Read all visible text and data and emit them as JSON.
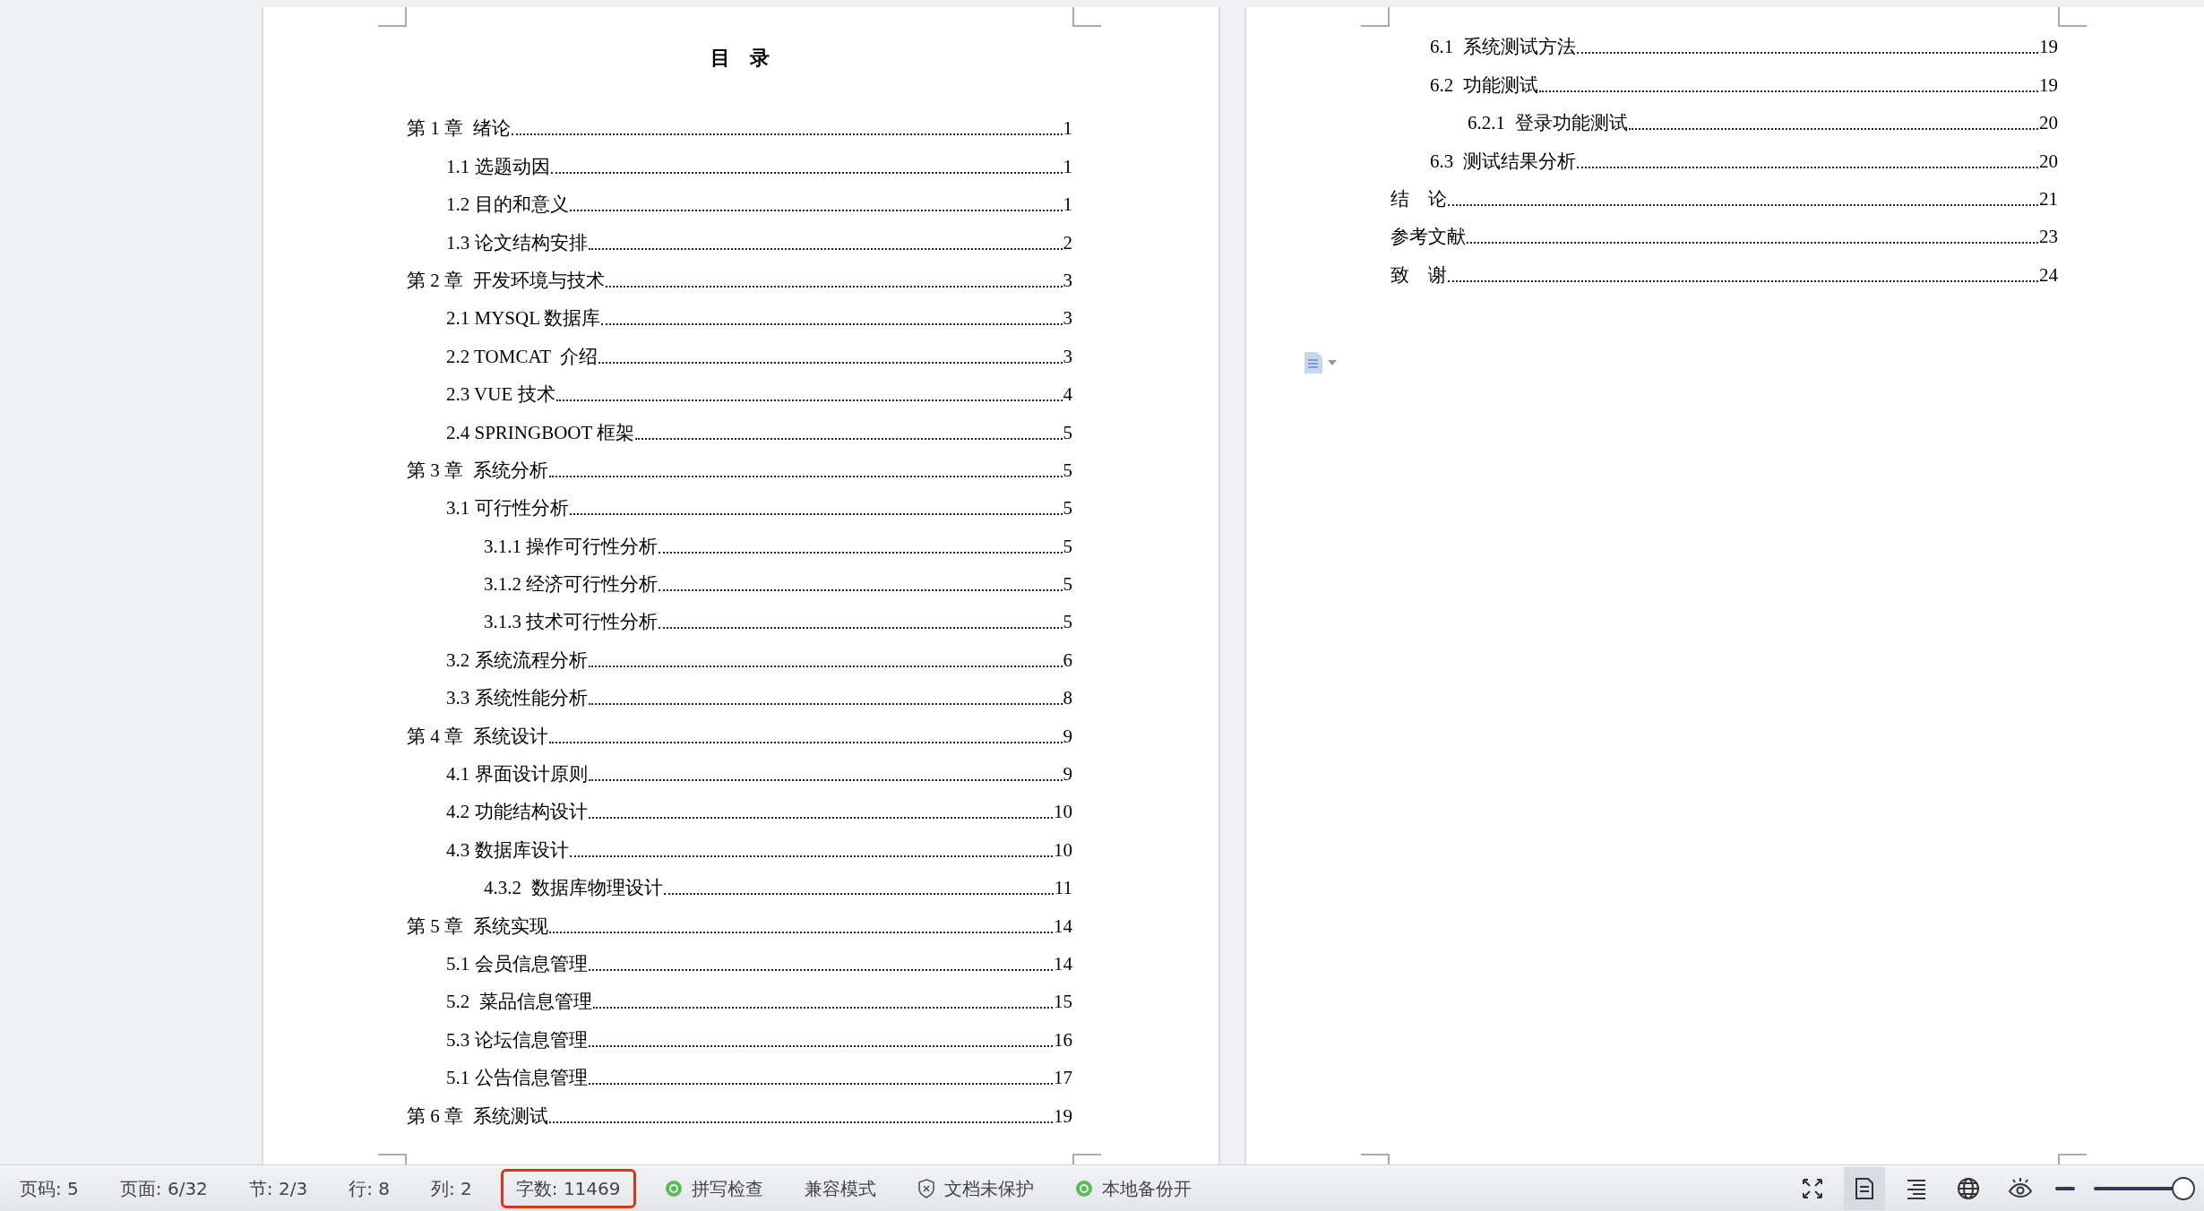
{
  "document": {
    "title": "目　录",
    "left_page": {
      "entries": [
        {
          "label": "第 1 章  绪论",
          "page": "1",
          "children": [
            {
              "label": "1.1 选题动因",
              "page": "1"
            },
            {
              "label": "1.2 目的和意义",
              "page": "1"
            },
            {
              "label": "1.3 论文结构安排",
              "page": "2"
            }
          ]
        },
        {
          "label": "第 2 章  开发环境与技术",
          "page": "3",
          "children": [
            {
              "label": "2.1 MYSQL 数据库",
              "page": "3"
            },
            {
              "label": "2.2 TOMCAT  介绍",
              "page": "3"
            },
            {
              "label": "2.3 VUE 技术",
              "page": "4"
            },
            {
              "label": "2.4 SPRINGBOOT 框架",
              "page": "5"
            }
          ]
        },
        {
          "label": "第 3 章  系统分析",
          "page": "5",
          "children": [
            {
              "label": "3.1 可行性分析",
              "page": "5",
              "children": [
                {
                  "label": "3.1.1 操作可行性分析",
                  "page": "5"
                },
                {
                  "label": "3.1.2 经济可行性分析",
                  "page": "5"
                },
                {
                  "label": "3.1.3 技术可行性分析",
                  "page": "5"
                }
              ]
            },
            {
              "label": "3.2 系统流程分析",
              "page": "6"
            },
            {
              "label": "3.3 系统性能分析",
              "page": "8"
            }
          ]
        },
        {
          "label": "第 4 章  系统设计",
          "page": "9",
          "children": [
            {
              "label": "4.1 界面设计原则",
              "page": "9"
            },
            {
              "label": "4.2 功能结构设计",
              "page": "10"
            },
            {
              "label": "4.3 数据库设计",
              "page": "10",
              "children": [
                {
                  "label": "4.3.2  数据库物理设计",
                  "page": "11"
                }
              ]
            }
          ]
        },
        {
          "label": "第 5 章  系统实现",
          "page": "14",
          "children": [
            {
              "label": "5.1 会员信息管理",
              "page": "14"
            },
            {
              "label": "5.2  菜品信息管理",
              "page": "15"
            },
            {
              "label": "5.3 论坛信息管理",
              "page": "16"
            },
            {
              "label": "5.1 公告信息管理",
              "page": "17"
            }
          ]
        },
        {
          "label": "第 6 章  系统测试",
          "page": "19"
        }
      ]
    },
    "right_page": {
      "continued": [
        {
          "label": "6.1  系统测试方法",
          "page": "19"
        },
        {
          "label": "6.2  功能测试",
          "page": "19",
          "children": [
            {
              "label": "6.2.1  登录功能测试",
              "page": "20"
            }
          ]
        },
        {
          "label": "6.3  测试结果分析",
          "page": "20"
        }
      ],
      "entries": [
        {
          "label": "结　论",
          "page": "21"
        },
        {
          "label": "参考文献",
          "page": "23"
        },
        {
          "label": "致　谢",
          "page": "24"
        }
      ]
    }
  },
  "status_bar": {
    "items": [
      {
        "kind": "text",
        "label": "页码: 5",
        "highlighted": false
      },
      {
        "kind": "text",
        "label": "页面: 6/32",
        "highlighted": false
      },
      {
        "kind": "text",
        "label": "节: 2/3",
        "highlighted": false
      },
      {
        "kind": "text",
        "label": "行: 8",
        "highlighted": false
      },
      {
        "kind": "text",
        "label": "列: 2",
        "highlighted": false
      },
      {
        "kind": "text",
        "label": "字数: 11469",
        "highlighted": true
      },
      {
        "kind": "toggle",
        "label": "拼写检查",
        "highlighted": false
      },
      {
        "kind": "text",
        "label": "兼容模式",
        "highlighted": false
      },
      {
        "kind": "shield",
        "label": "文档未保护",
        "highlighted": false
      },
      {
        "kind": "toggle",
        "label": "本地备份开",
        "highlighted": false
      }
    ],
    "views": [
      {
        "kind": "fullscreen",
        "selected": false
      },
      {
        "kind": "page",
        "selected": true
      },
      {
        "kind": "outline",
        "selected": false
      },
      {
        "kind": "web",
        "selected": false
      },
      {
        "kind": "reading",
        "selected": false
      }
    ],
    "zoom": {
      "level": 0.96
    }
  }
}
